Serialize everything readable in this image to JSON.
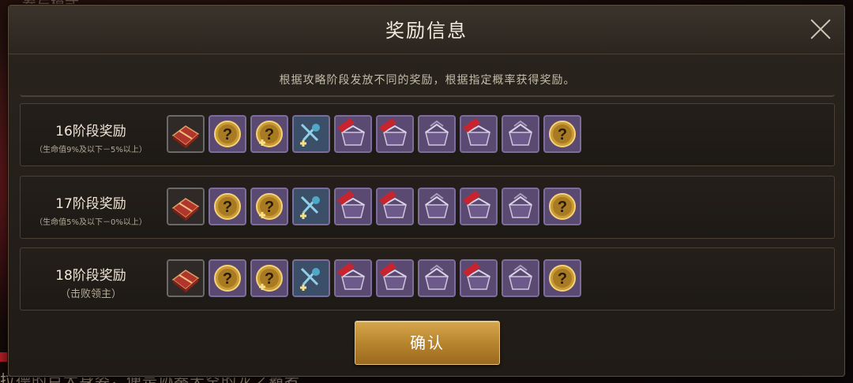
{
  "background": {
    "top_text": "参与模式",
    "bottom_text": "拉德的巨大身姿，便是协奏天空的龙之霸者"
  },
  "dialog": {
    "title": "奖励信息",
    "subtitle": "根据攻略阶段发放不同的奖励，根据指定概率获得奖励。",
    "confirm_label": "确认"
  },
  "tiers": [
    {
      "name": "16阶段奖励",
      "condition": "（生命值9%及以下－5%以上）",
      "items": [
        "red-chest-icon",
        "gold-mystery-coin-icon",
        "gold-mystery-coin-plus-icon",
        "blue-equipment-icon",
        "red-ribbon-crate-icon",
        "red-ribbon-crate-icon",
        "purple-crate-icon",
        "red-ribbon-crate-icon",
        "purple-crate-icon",
        "gold-mystery-coin-icon"
      ]
    },
    {
      "name": "17阶段奖励",
      "condition": "（生命值5%及以下－0%以上）",
      "items": [
        "red-chest-icon",
        "gold-mystery-coin-icon",
        "gold-mystery-coin-plus-icon",
        "blue-equipment-icon",
        "red-ribbon-crate-icon",
        "red-ribbon-crate-icon",
        "purple-crate-icon",
        "red-ribbon-crate-icon",
        "purple-crate-icon",
        "gold-mystery-coin-icon"
      ]
    },
    {
      "name": "18阶段奖励",
      "condition": "（击败领主）",
      "items": [
        "red-chest-icon",
        "gold-mystery-coin-icon",
        "gold-mystery-coin-plus-icon",
        "blue-equipment-icon",
        "red-ribbon-crate-icon",
        "red-ribbon-crate-icon",
        "purple-crate-icon",
        "red-ribbon-crate-icon",
        "purple-crate-icon",
        "gold-mystery-coin-icon"
      ]
    }
  ],
  "colors": {
    "accent_gold": "#c9953a",
    "panel": "#241f1a",
    "item_purple": "#5a4a72"
  }
}
